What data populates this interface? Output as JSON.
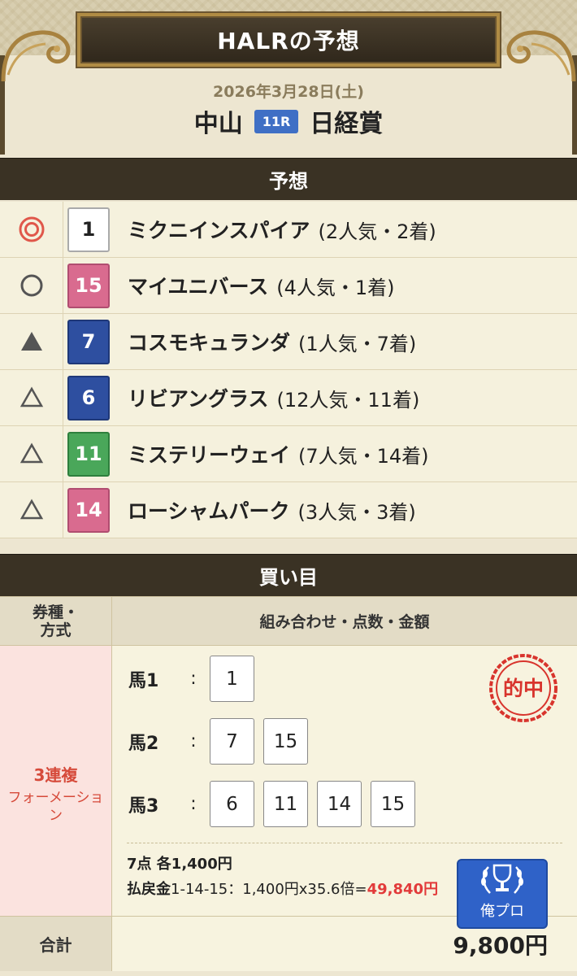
{
  "header": {
    "title": "HALRの予想",
    "date": "2026年3月28日(土)",
    "venue": "中山",
    "race_number": "11R",
    "race_name": "日経賞"
  },
  "prediction_section": {
    "title": "予想",
    "rows": [
      {
        "mark": "double-circle",
        "number": "1",
        "frame_color": "white",
        "horse": "ミクニインスパイア",
        "info": "(2人気・2着)"
      },
      {
        "mark": "circle",
        "number": "15",
        "frame_color": "pink",
        "horse": "マイユニバース",
        "info": "(4人気・1着)"
      },
      {
        "mark": "filled-triangle",
        "number": "7",
        "frame_color": "blue",
        "horse": "コスモキュランダ",
        "info": "(1人気・7着)"
      },
      {
        "mark": "triangle",
        "number": "6",
        "frame_color": "blue",
        "horse": "リビアングラス",
        "info": "(12人気・11着)"
      },
      {
        "mark": "triangle",
        "number": "11",
        "frame_color": "green",
        "horse": "ミステリーウェイ",
        "info": "(7人気・14着)"
      },
      {
        "mark": "triangle",
        "number": "14",
        "frame_color": "pink",
        "horse": "ローシャムパーク",
        "info": "(3人気・3着)"
      }
    ]
  },
  "betting_section": {
    "title": "買い目",
    "col_type_header": "券種・方式",
    "col_type_header_line1": "券種・",
    "col_type_header_line2": "方式",
    "col_detail_header": "組み合わせ・点数・金額",
    "bet_type": "3連複",
    "bet_method": "フォーメーション",
    "horse_rows": [
      {
        "label": "馬1",
        "colon": ":",
        "numbers": [
          "1"
        ]
      },
      {
        "label": "馬2",
        "colon": ":",
        "numbers": [
          "7",
          "15"
        ]
      },
      {
        "label": "馬3",
        "colon": ":",
        "numbers": [
          "6",
          "11",
          "14",
          "15"
        ]
      }
    ],
    "hit_stamp": "的中",
    "points_text": "7点 各1,400円",
    "payout_label": "払戻金",
    "payout_detail": "1-14-15：1,400円x35.6倍=",
    "payout_amount": "49,840",
    "payout_unit": "円",
    "pro_badge_label": "俺プロ",
    "total_label": "合計",
    "total_value": "9,800円"
  },
  "colors": {
    "frame_white": "#ffffff",
    "frame_pink": "#d96b8f",
    "frame_blue": "#2e4fa0",
    "frame_green": "#4aa75a",
    "accent_red": "#e23a3a",
    "race_badge_blue": "#3f6fc5"
  }
}
